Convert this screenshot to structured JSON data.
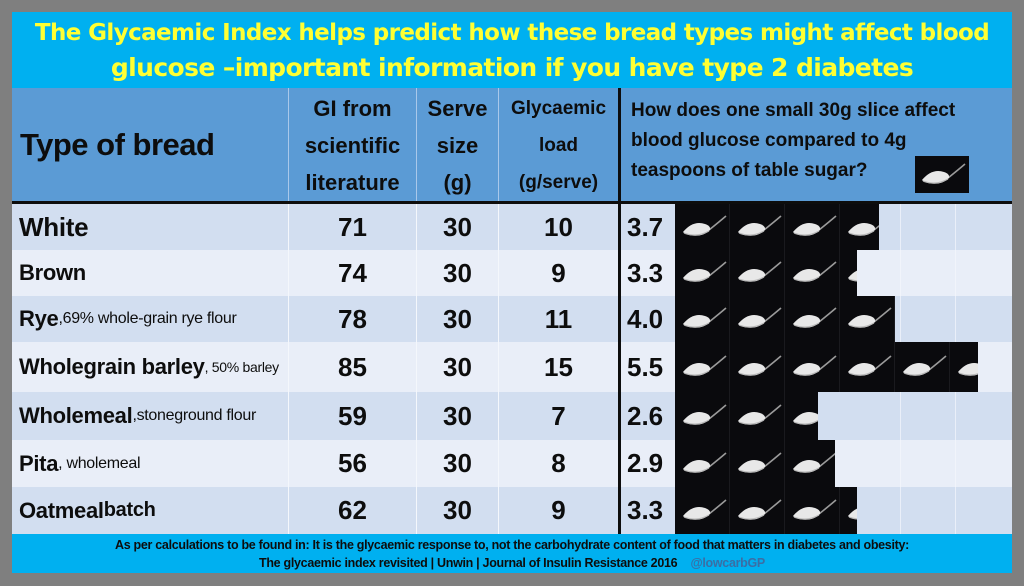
{
  "title": {
    "line1": "The Glycaemic Index helps predict how these bread types might affect blood",
    "line2": "glucose –important information if you have type 2 diabetes"
  },
  "colors": {
    "title_band": "#00b0f0",
    "title_text": "#ffff33",
    "header_bg": "#5b9bd5",
    "row_odd": "#d2def0",
    "row_even": "#e9eef8",
    "spoon_bg": "#0a0a0d",
    "handle": "#3a6ea5"
  },
  "header": {
    "type": "Type of bread",
    "gi": [
      "GI from",
      "scientific",
      "literature"
    ],
    "serve": [
      "Serve",
      "size",
      "(g)"
    ],
    "load": [
      "Glycaemic",
      "load",
      "(g/serve)"
    ],
    "question": [
      "How does one small 30g slice affect",
      "blood glucose compared to 4g",
      "teaspoons of table sugar?"
    ],
    "icon": "teaspoon-sugar-icon"
  },
  "rows": [
    {
      "name": "White",
      "detail": "",
      "gi": "71",
      "serve": "30",
      "load": "10",
      "teaspoons": "3.7",
      "teaspoons_value": 3.7
    },
    {
      "name": "Brown",
      "detail": "",
      "gi": "74",
      "serve": "30",
      "load": "9",
      "teaspoons": "3.3",
      "teaspoons_value": 3.3
    },
    {
      "name": "Rye",
      "detail": " ,69% whole-grain rye flour",
      "gi": "78",
      "serve": "30",
      "load": "11",
      "teaspoons": "4.0",
      "teaspoons_value": 4.0
    },
    {
      "name": "Wholegrain barley",
      "detail": ", 50% barley",
      "gi": "85",
      "serve": "30",
      "load": "15",
      "teaspoons": "5.5",
      "teaspoons_value": 5.5
    },
    {
      "name": "Wholemeal",
      "detail": ",stoneground flour",
      "gi": "59",
      "serve": "30",
      "load": "7",
      "teaspoons": "2.6",
      "teaspoons_value": 2.6
    },
    {
      "name": "Pita",
      "detail": ", wholemeal",
      "gi": "56",
      "serve": "30",
      "load": "8",
      "teaspoons": "2.9",
      "teaspoons_value": 2.9
    },
    {
      "name": "Oatmeal",
      "detail": " batch",
      "gi": "62",
      "serve": "30",
      "load": "9",
      "teaspoons": "3.3",
      "teaspoons_value": 3.3
    }
  ],
  "footer": {
    "line1": "As per calculations to be found in: It is the glycaemic response to, not the carbohydrate content of food that matters in diabetes and obesity:",
    "line2": "The glycaemic index revisited | Unwin | Journal of Insulin Resistance 2016",
    "handle": "@lowcarbGP"
  }
}
